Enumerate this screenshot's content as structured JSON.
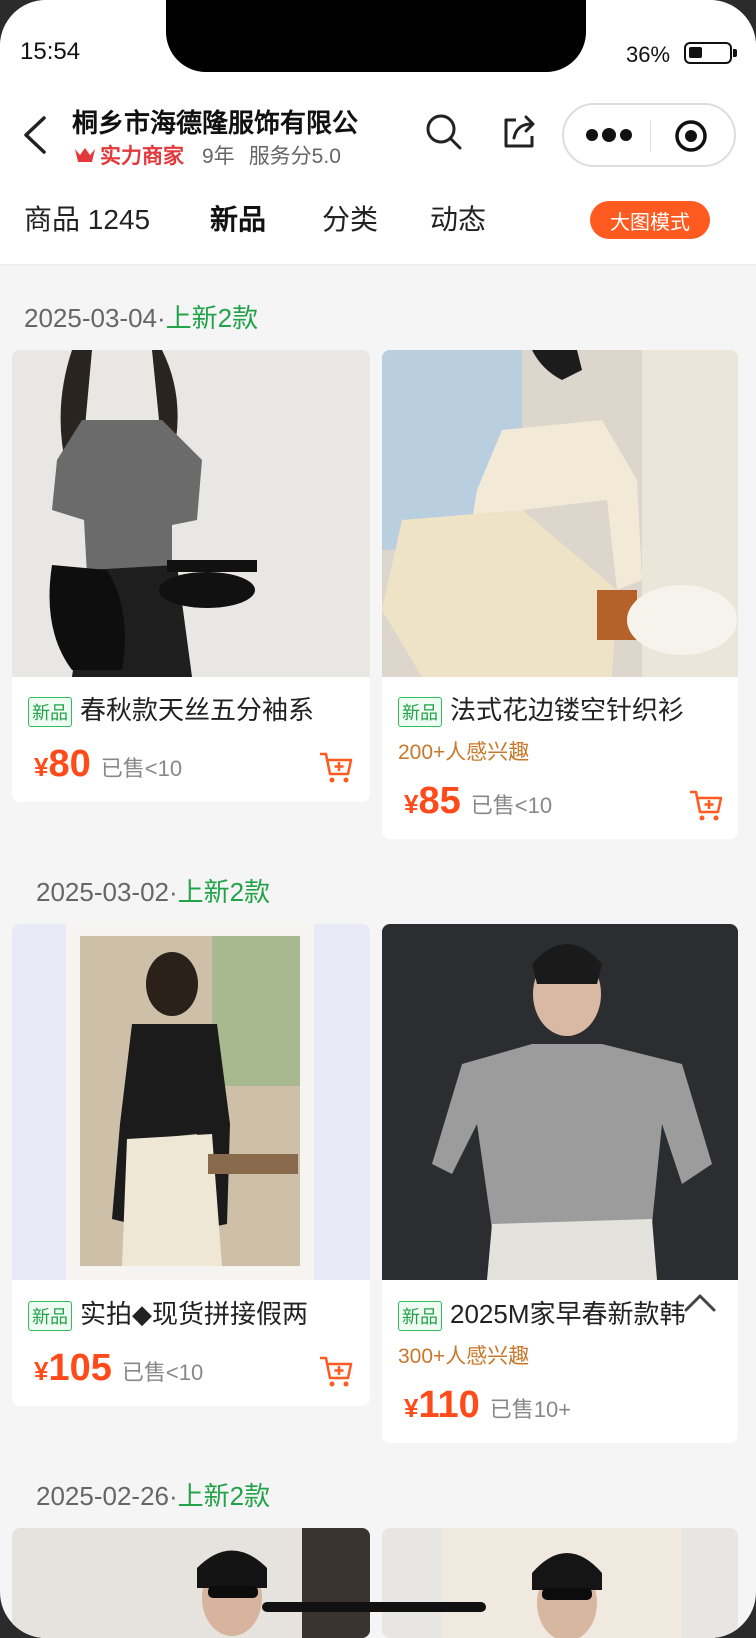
{
  "status": {
    "time": "15:54",
    "battery": "36%"
  },
  "header": {
    "store_name": "桐乡市海德隆服饰有限公",
    "badge": "实力商家",
    "years": "9年",
    "service_score": "服务分5.0"
  },
  "tabs": {
    "products_label": "商品",
    "products_count": "1245",
    "new_label": "新品",
    "category_label": "分类",
    "feed_label": "动态",
    "big_image_mode": "大图模式"
  },
  "sections": [
    {
      "date": "2025-03-04",
      "dot": "·",
      "new_count": "上新2款"
    },
    {
      "date": "2025-03-02",
      "dot": "·",
      "new_count": "上新2款"
    },
    {
      "date": "2025-02-26",
      "dot": "·",
      "new_count": "上新2款"
    }
  ],
  "products": [
    {
      "tag": "新品",
      "title": "春秋款天丝五分袖系",
      "interest": "",
      "yen": "¥",
      "price": "80",
      "sold": "已售<10"
    },
    {
      "tag": "新品",
      "title": "法式花边镂空针织衫",
      "interest": "200+人感兴趣",
      "yen": "¥",
      "price": "85",
      "sold": "已售<10"
    },
    {
      "tag": "新品",
      "title": "实拍◆现货拼接假两",
      "interest": "",
      "yen": "¥",
      "price": "105",
      "sold": "已售<10"
    },
    {
      "tag": "新品",
      "title": "2025M家早春新款韩",
      "interest": "300+人感兴趣",
      "yen": "¥",
      "price": "110",
      "sold": "已售10+"
    }
  ],
  "colors": {
    "accent": "#ff4a1a",
    "new_green": "#22a34a",
    "interest": "#c9782a"
  },
  "icons": [
    "back-icon",
    "search-icon",
    "share-icon",
    "more-icon",
    "target-icon",
    "cart-icon",
    "chevron-up-icon"
  ]
}
